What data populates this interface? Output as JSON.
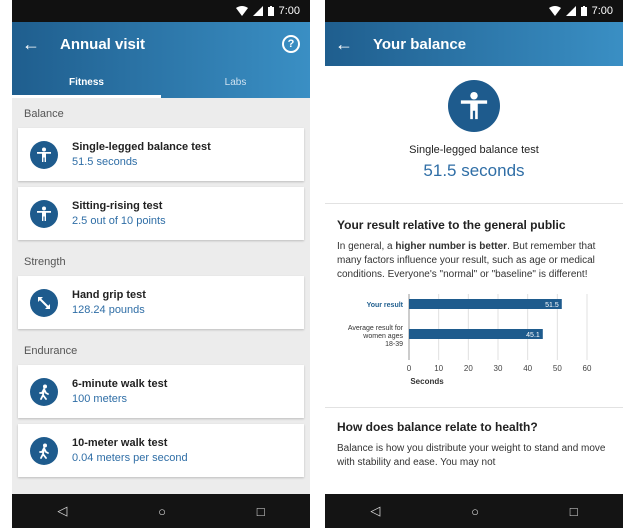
{
  "status_time": "7:00",
  "nav": {
    "back": "◁",
    "home": "○",
    "recent": "□"
  },
  "left": {
    "title": "Annual visit",
    "help": "?",
    "tabs": [
      "Fitness",
      "Labs"
    ],
    "sections": [
      {
        "label": "Balance",
        "items": [
          {
            "name": "Single-legged balance test",
            "value": "51.5 seconds",
            "icon": "person-icon"
          },
          {
            "name": "Sitting-rising test",
            "value": "2.5 out of 10 points",
            "icon": "person-icon"
          }
        ]
      },
      {
        "label": "Strength",
        "items": [
          {
            "name": "Hand grip test",
            "value": "128.24 pounds",
            "icon": "resize-arrows-icon"
          }
        ]
      },
      {
        "label": "Endurance",
        "items": [
          {
            "name": "6-minute walk test",
            "value": "100 meters",
            "icon": "walking-icon"
          },
          {
            "name": "10-meter walk test",
            "value": "0.04 meters per second",
            "icon": "walking-icon"
          }
        ]
      }
    ]
  },
  "right": {
    "title": "Your balance",
    "test_name": "Single-legged balance test",
    "test_value": "51.5 seconds",
    "relative_heading": "Your result relative to the general public",
    "relative_text_pre": "In general, a ",
    "relative_text_bold": "higher number is better",
    "relative_text_post": ". But remember that many factors influence your result, such as age or medical conditions. Everyone's \"normal\" or \"baseline\" is different!",
    "health_heading": "How does balance relate to health?",
    "health_text": "Balance is how you distribute your weight to stand and move with stability and ease. You may not"
  },
  "chart_data": {
    "type": "bar",
    "orientation": "horizontal",
    "categories": [
      "Your result",
      "Average result for women ages 18-39"
    ],
    "values": [
      51.5,
      45.1
    ],
    "xlabel": "Seconds",
    "xlim": [
      0,
      60
    ],
    "xticks": [
      0,
      10,
      20,
      30,
      40,
      50,
      60
    ],
    "grid": true,
    "colors": {
      "your_result": "#1e5b8d",
      "average": "#1e5b8d",
      "label_blue": "#1f5e8e"
    }
  }
}
